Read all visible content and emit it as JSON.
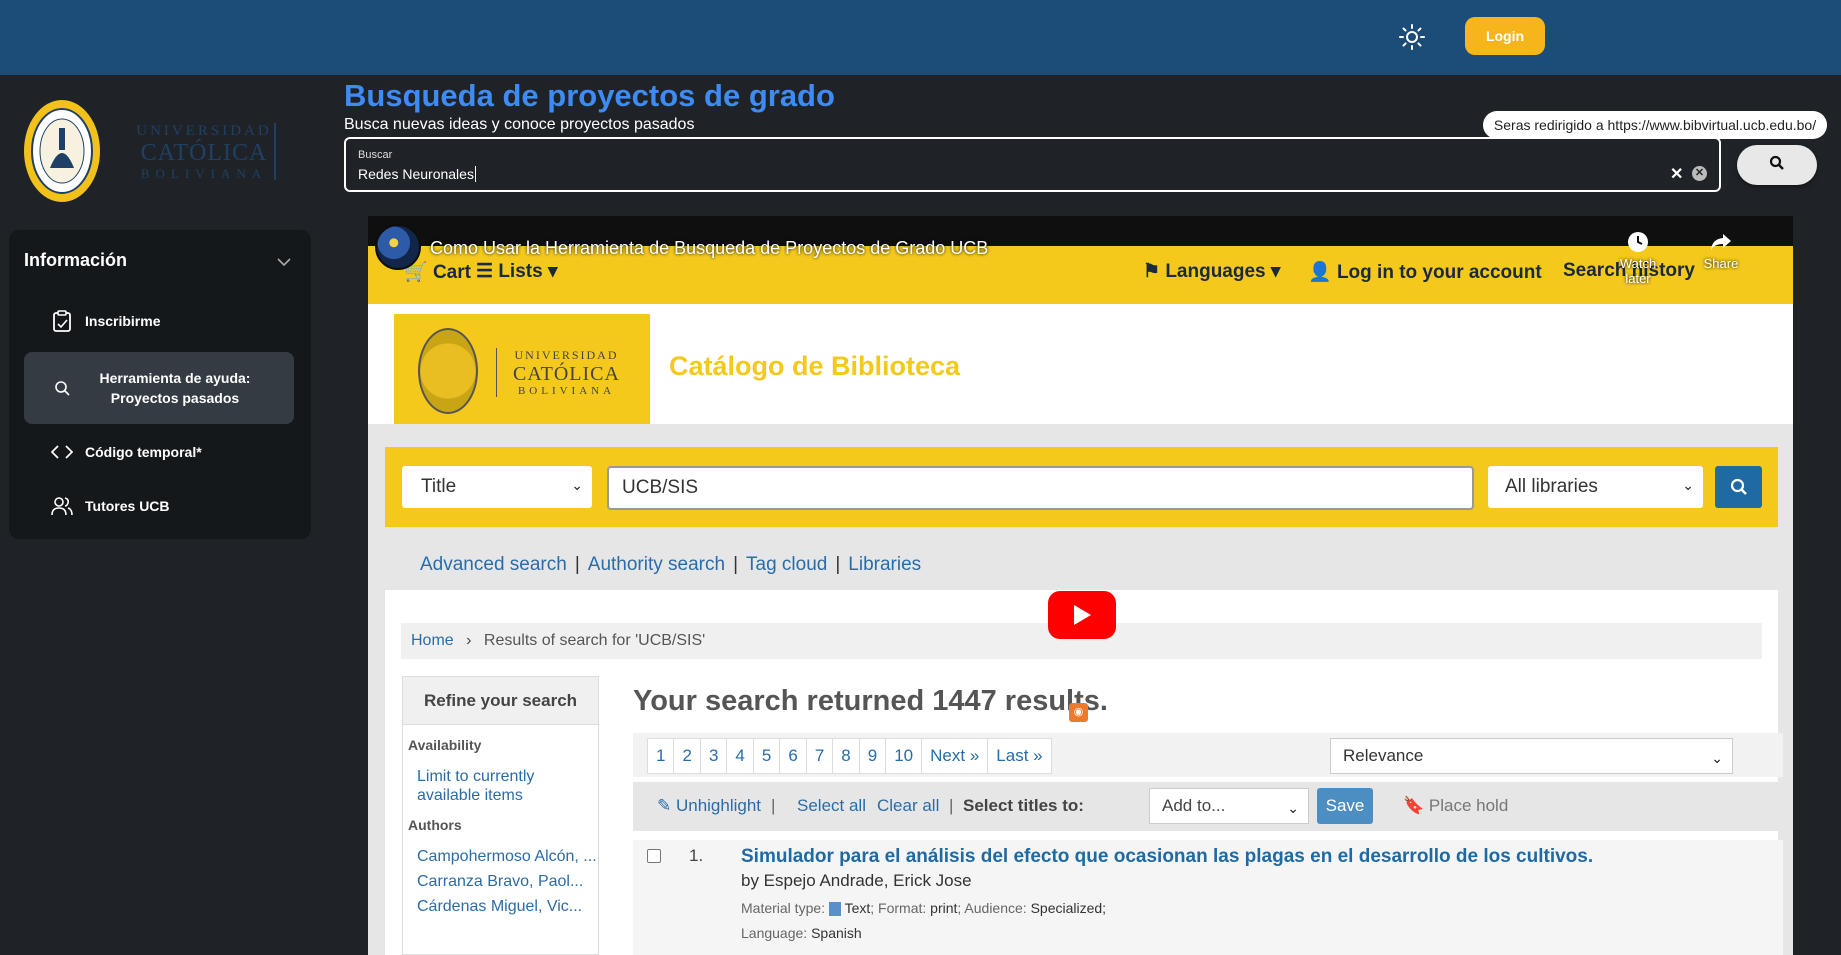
{
  "header": {
    "login_label": "Login"
  },
  "logo": {
    "line1": "UNIVERSIDAD",
    "line2": "CATÓLICA",
    "line3": "BOLIVIANA"
  },
  "sidebar": {
    "title": "Información",
    "items": [
      {
        "label": "Inscribirme",
        "icon": "clipboard-icon"
      },
      {
        "label": "Herramienta de ayuda: Proyectos pasados",
        "icon": "search-icon"
      },
      {
        "label": "Código temporal*",
        "icon": "code-icon"
      },
      {
        "label": "Tutores UCB",
        "icon": "users-icon"
      }
    ]
  },
  "main": {
    "title": "Busqueda de proyectos de grado",
    "subtitle": "Busca nuevas ideas y conoce proyectos pasados",
    "tooltip": "Seras redirigido a https://www.bibvirtual.ucb.edu.bo/",
    "search": {
      "label": "Buscar",
      "value": "Redes Neuronales"
    }
  },
  "video": {
    "title": "Como Usar la Herramienta de Busqueda de Proyectos de Grado UCB",
    "watch_later": "Watch later",
    "share": "Share",
    "nav": {
      "cart": "Cart",
      "lists": "Lists",
      "languages": "Languages",
      "login": "Log in to your account",
      "search_history": "Search history"
    },
    "catalog": {
      "logo_line1": "UNIVERSIDAD",
      "logo_line2": "CATÓLICA",
      "logo_line3": "BOLIVIANA",
      "title": "Catálogo de Biblioteca",
      "search_type": "Title",
      "query": "UCB/SIS",
      "libraries": "All libraries",
      "links": [
        "Advanced search",
        "Authority search",
        "Tag cloud",
        "Libraries"
      ],
      "breadcrumb_home": "Home",
      "breadcrumb_current": "Results of search for 'UCB/SIS'",
      "refine_title": "Refine your search",
      "availability_label": "Availability",
      "availability_link": "Limit to currently available items",
      "authors_label": "Authors",
      "authors": [
        "Campohermoso Alcón, ...",
        "Carranza Bravo, Paol...",
        "Cárdenas Miguel, Vic..."
      ],
      "result_count_text": "Your search returned 1447 results.",
      "pages": [
        "1",
        "2",
        "3",
        "4",
        "5",
        "6",
        "7",
        "8",
        "9",
        "10",
        "Next »",
        "Last »"
      ],
      "sort": "Relevance",
      "toolbar": {
        "unhighlight": "Unhighlight",
        "select_all": "Select all",
        "clear_all": "Clear all",
        "select_titles": "Select titles to:",
        "add_to": "Add to...",
        "save": "Save",
        "place_hold": "Place hold"
      },
      "result1": {
        "num": "1.",
        "title": "Simulador para el análisis del efecto que ocasionan las plagas en el desarrollo de los cultivos.",
        "author": "by Espejo Andrade, Erick Jose",
        "material_label": "Material type:",
        "material_value": "Text",
        "format_label": "; Format:",
        "format_value": "print",
        "audience_label": "; Audience:",
        "audience_value": "Specialized;",
        "language_label": "Language:",
        "language_value": "Spanish"
      }
    }
  },
  "colors": {
    "topbar": "#1c4d78",
    "accent_blue": "#3d8bf3",
    "login": "#f7b51c",
    "catalog_yellow": "#f4c91c"
  }
}
